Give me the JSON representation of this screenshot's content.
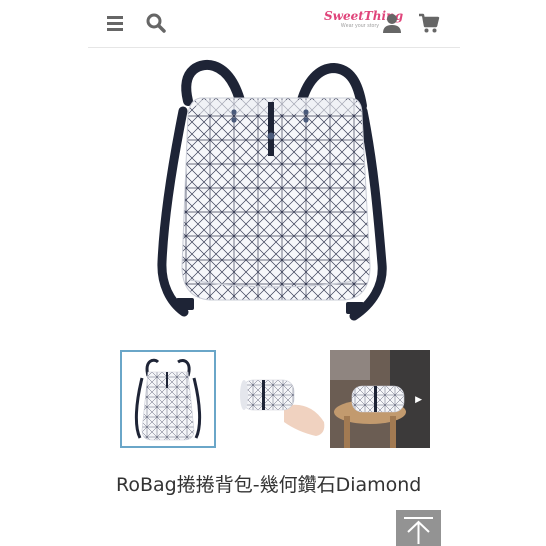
{
  "header": {
    "menu_icon": "hamburger-menu-icon",
    "search_icon": "search-icon",
    "user_icon": "user-icon",
    "cart_icon": "cart-icon",
    "logo": {
      "brand": "SweetThing",
      "tagline": "Wear your story"
    }
  },
  "product": {
    "title": "RoBag捲捲背包-幾何鑽石Diamond",
    "thumbnails": [
      {
        "selected": true
      },
      {
        "selected": false
      },
      {
        "selected": false
      }
    ]
  },
  "controls": {
    "back_to_top_icon": "arrow-up-icon"
  },
  "colors": {
    "brand": "#e0457b",
    "icon": "#666666",
    "strap": "#1e2436",
    "pattern": "#3a3f57",
    "thumb_border": "#6aa6c8"
  }
}
